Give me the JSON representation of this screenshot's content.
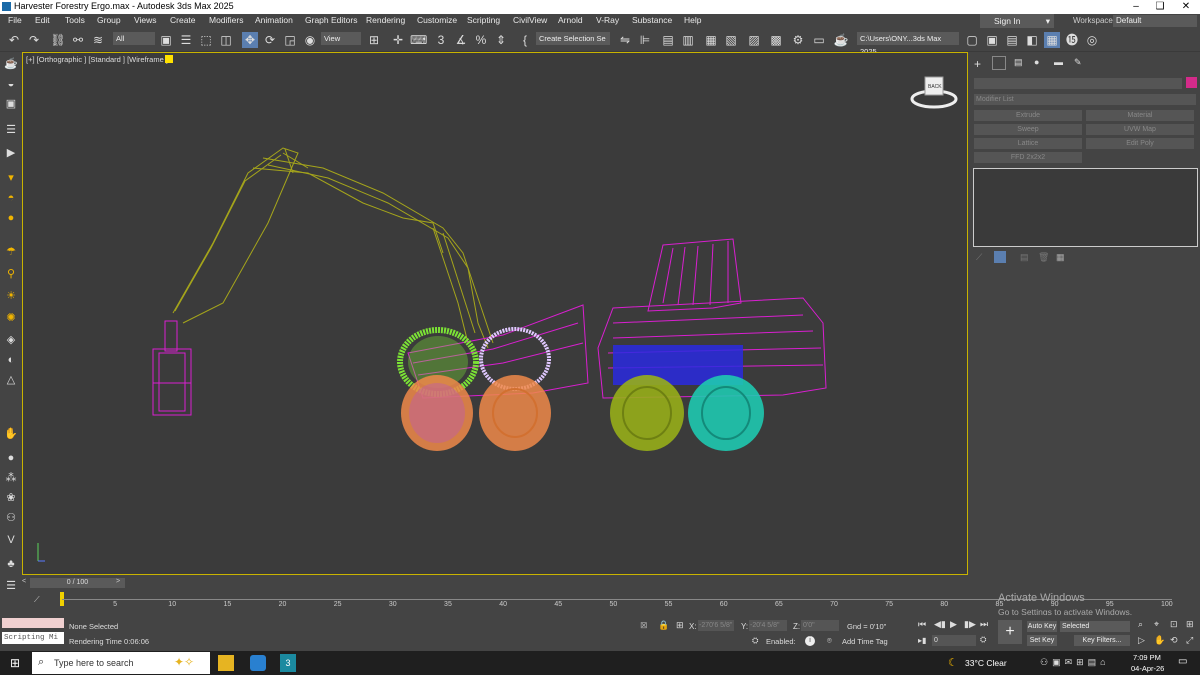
{
  "window": {
    "title": "Harvester Forestry Ergo.max - Autodesk 3ds Max 2025",
    "min": "–",
    "max": "❑",
    "close": "✕"
  },
  "menu": [
    "File",
    "Edit",
    "Tools",
    "Group",
    "Views",
    "Create",
    "Modifiers",
    "Animation",
    "Graph Editors",
    "Rendering",
    "Customize",
    "Scripting",
    "CivilView",
    "Arnold",
    "V-Ray",
    "Substance",
    "Help"
  ],
  "signin": "Sign In",
  "workspaces": {
    "label": "Workspaces:",
    "value": "Default"
  },
  "toolbar": {
    "selection_filter": "All",
    "ref_coord": "View",
    "named_selection": "Create Selection Se",
    "project_path": "C:\\Users\\ONY...3ds Max 2025"
  },
  "viewport": {
    "label": "[+] [Orthographic ] [Standard ] [Wireframe ]",
    "viewcube_label": "BACK",
    "colors": {
      "boom": "#a5a51b",
      "body": "#d91fd0",
      "wheel_lime": "#7ce335",
      "wheel_orange": "#f08a4a",
      "wheel_olive": "#97ae19",
      "wheel_cyan": "#1fc9b0",
      "chassis_blue": "#2a2ae0"
    }
  },
  "command_panel": {
    "modifier_list": "Modifier List",
    "buttons": [
      "Extrude",
      "Material",
      "Sweep",
      "UVW Map",
      "Lattice",
      "Edit Poly",
      "FFD 2x2x2"
    ],
    "color_swatch": "#d42b8a"
  },
  "timeslider": {
    "value": "0 / 100",
    "prev": "<",
    "next": ">"
  },
  "trackbar": {
    "ticks": [
      "5",
      "10",
      "15",
      "20",
      "25",
      "30",
      "35",
      "40",
      "45",
      "50",
      "55",
      "60",
      "65",
      "70",
      "75",
      "80",
      "85",
      "90",
      "95",
      "100"
    ]
  },
  "status": {
    "maxscript": "Scripting Mi",
    "selection": "None Selected",
    "render_time": "Rendering Time  0:06:06",
    "x_label": "X:",
    "x_val": "-270'6 5/8\"",
    "y_label": "Y:",
    "y_val": "-20'4 5/8\"",
    "z_label": "Z:",
    "z_val": "0'0\"",
    "grid": "Gnd = 0'10\"",
    "enabled": "Enabled:",
    "add_time_tag": "Add Time Tag",
    "auto_key": "Auto Key",
    "set_key": "Set Key",
    "key_mode": "Selected",
    "key_filters": "Key Filters...",
    "frame": "0"
  },
  "activate": {
    "line1": "Activate Windows",
    "line2": "Go to Settings to activate Windows."
  },
  "taskbar": {
    "search": "Type here to search",
    "weather": "33°C  Clear",
    "time": "7:09 PM",
    "date": "04-Apr-26"
  }
}
